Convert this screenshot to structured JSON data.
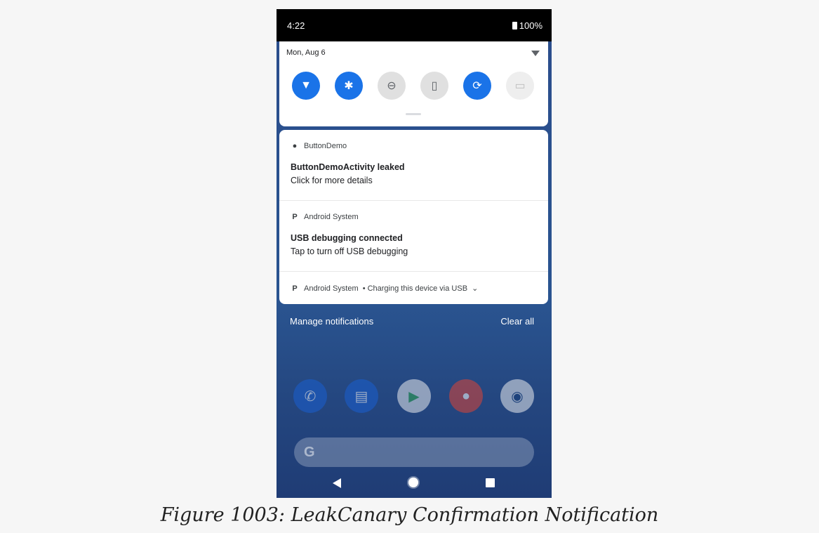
{
  "status_bar": {
    "time": "4:22",
    "battery": "100%"
  },
  "quick_settings": {
    "date": "Mon, Aug 6",
    "tiles": [
      {
        "name": "wifi",
        "state": "on",
        "glyph": "▼"
      },
      {
        "name": "bluetooth",
        "state": "on",
        "glyph": "✱"
      },
      {
        "name": "do-not-disturb",
        "state": "off",
        "glyph": "⊖"
      },
      {
        "name": "flashlight",
        "state": "off",
        "glyph": "▯"
      },
      {
        "name": "auto-rotate",
        "state": "on",
        "glyph": "⟳"
      },
      {
        "name": "battery-saver",
        "state": "disabled",
        "glyph": "▭"
      }
    ]
  },
  "notifications": [
    {
      "app": "ButtonDemo",
      "title": "ButtonDemoActivity leaked",
      "body": "Click for more details"
    },
    {
      "app": "Android System",
      "title": "USB debugging connected",
      "body": "Tap to turn off USB debugging"
    },
    {
      "app": "Android System",
      "summary": "Charging this device via USB",
      "separator": "•"
    }
  ],
  "footer": {
    "manage": "Manage notifications",
    "clear": "Clear all"
  },
  "search": {
    "glyph": "G"
  },
  "caption": "Figure 1003: LeakCanary Confirmation Notification"
}
